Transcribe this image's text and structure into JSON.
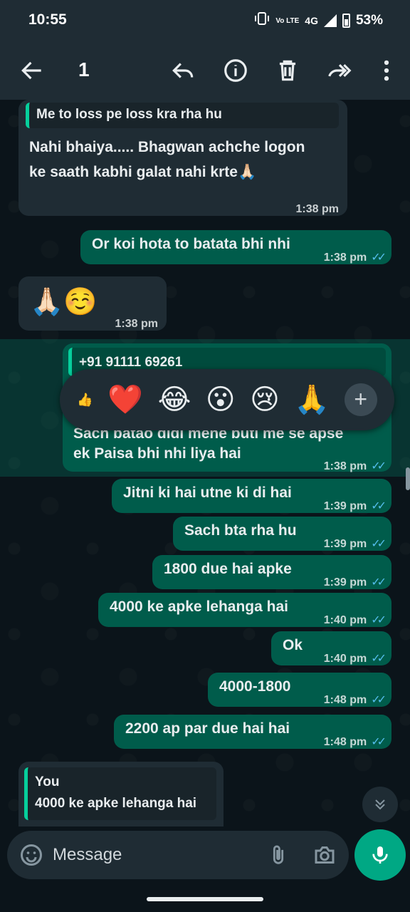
{
  "status": {
    "time": "10:55",
    "network": "4G",
    "volte": "Vo LTE",
    "battery": "53%"
  },
  "toolbar": {
    "selected_count": "1"
  },
  "messages": [
    {
      "quote": "Me to loss pe loss kra rha hu",
      "text_line1": "Nahi bhaiya..... Bhagwan achche logon",
      "text_line2": "ke saath kabhi galat nahi krte🙏🏻",
      "time": "1:38 pm"
    },
    {
      "text": "Or koi hota to batata bhi nhi",
      "time": "1:38 pm"
    },
    {
      "text": "🙏🏻☺️",
      "time": "1:38 pm"
    },
    {
      "quote_sender": "+91 91111 69261",
      "text_line1": "Sach batao didi mene buti me se apse",
      "text_line2": "ek Paisa bhi nhi liya hai",
      "time": "1:38 pm"
    },
    {
      "text": "Jitni ki hai utne ki di hai",
      "time": "1:39 pm"
    },
    {
      "text": "Sach bta rha hu",
      "time": "1:39 pm"
    },
    {
      "text": "1800 due hai apke",
      "time": "1:39 pm"
    },
    {
      "text": "4000 ke apke lehanga hai",
      "time": "1:40 pm"
    },
    {
      "text": "Ok",
      "time": "1:40 pm"
    },
    {
      "text": "4000-1800",
      "time": "1:48 pm"
    },
    {
      "text": "2200 ap par due hai hai",
      "time": "1:48 pm"
    }
  ],
  "reply_preview": {
    "sender": "You",
    "text": "4000 ke apke lehanga hai"
  },
  "reactions": [
    "👍",
    "❤️",
    "😂",
    "😮",
    "😢",
    "🙏",
    "+"
  ],
  "composer": {
    "placeholder": "Message"
  },
  "colors": {
    "incoming": "#1f2c34",
    "outgoing": "#005c4b",
    "accent": "#00a884",
    "read_ticks": "#53bdeb"
  },
  "icons": [
    "back-arrow-icon",
    "reply-icon",
    "info-icon",
    "delete-icon",
    "forward-icon",
    "more-vert-icon",
    "emoji-icon",
    "attach-icon",
    "camera-icon",
    "mic-icon",
    "scroll-down-icon"
  ]
}
